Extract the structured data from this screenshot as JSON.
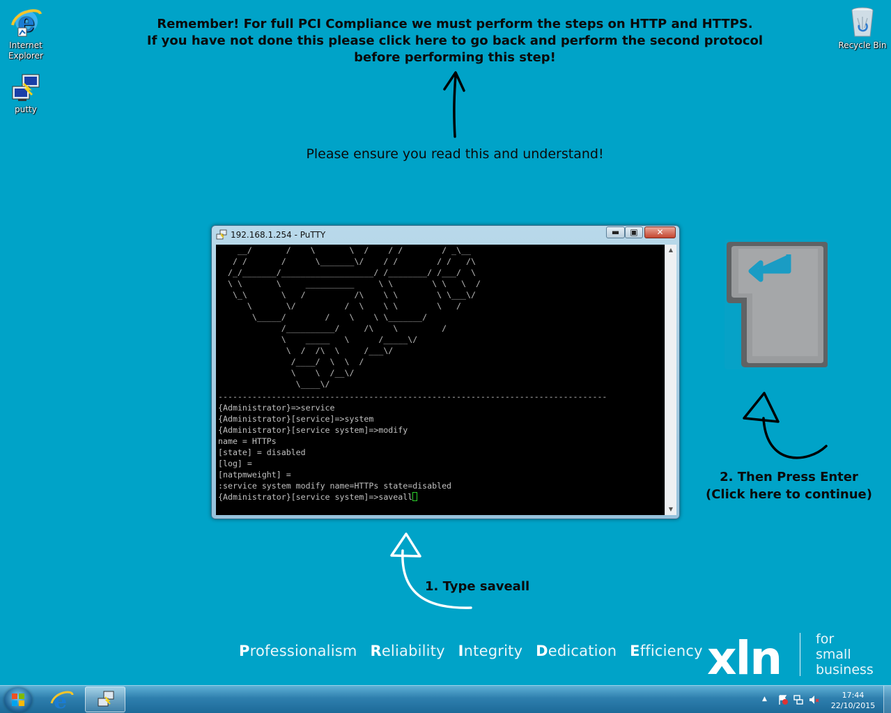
{
  "desktop": {
    "icons": [
      {
        "label_lines": [
          "Internet",
          "Explorer"
        ]
      },
      {
        "label_lines": [
          "putty"
        ]
      },
      {
        "label_lines": [
          "Recycle Bin"
        ]
      }
    ]
  },
  "instructions": {
    "reminder_lines": [
      "Remember! For full PCI Compliance we must perform the steps on HTTP and HTTPS.",
      "If you have not done this please click here to go back and perform the second protocol",
      "before performing this step!"
    ],
    "ensure": "Please ensure you read this and understand!",
    "step1": "1. Type saveall",
    "step2_lines": [
      "2. Then Press Enter",
      "(Click here to continue)"
    ]
  },
  "putty": {
    "title": "192.168.1.254 - PuTTY",
    "buttons": {
      "minimize": "▬",
      "maximize": "▣",
      "close": "✕"
    },
    "ascii_art": [
      "    __/       /    \\       \\  /    / /        / _\\__",
      "   / /       /      \\_______\\/    / /        / /   /\\",
      "  /_/_______/___________________/ /________/ /___/  \\",
      "  \\ \\       \\     __________     \\ \\        \\ \\   \\  /",
      "   \\_\\       \\   /          /\\    \\ \\        \\ \\___\\/",
      "      \\       \\/          /  \\    \\ \\        \\   /",
      "       \\_____/        /    \\    \\ \\_______/",
      "             /__________/     /\\    \\         /",
      "             \\    _____   \\      /_____\\/",
      "              \\  /  /\\  \\     /___\\/",
      "               /____/  \\  \\  /",
      "               \\    \\  /__\\/",
      "                \\____\\/"
    ],
    "separator": "--------------------------------------------------------------------------------",
    "lines": [
      "{Administrator}=>service",
      "{Administrator}[service]=>system",
      "{Administrator}[service system]=>modify",
      "name = HTTPs",
      "[state] = disabled",
      "[log] =",
      "[natpmweight] =",
      ":service system modify name=HTTPs state=disabled"
    ],
    "prompt": "{Administrator}[service system]=>saveall"
  },
  "footer": {
    "values": [
      {
        "initial": "P",
        "rest": "rofessionalism"
      },
      {
        "initial": "R",
        "rest": "eliability"
      },
      {
        "initial": "I",
        "rest": "ntegrity"
      },
      {
        "initial": "D",
        "rest": "edication"
      },
      {
        "initial": "E",
        "rest": "fficiency"
      }
    ],
    "logo": "xln",
    "tagline_lines": [
      "for",
      "small",
      "business"
    ]
  },
  "taskbar": {
    "time": "17:44",
    "date": "22/10/2015"
  },
  "colors": {
    "desktop_bg": "#00a3c8",
    "terminal_bg": "#000000",
    "terminal_fg": "#c0c0c0",
    "cursor": "#2cd12c",
    "enter_key_accent": "#1a9cc4"
  }
}
